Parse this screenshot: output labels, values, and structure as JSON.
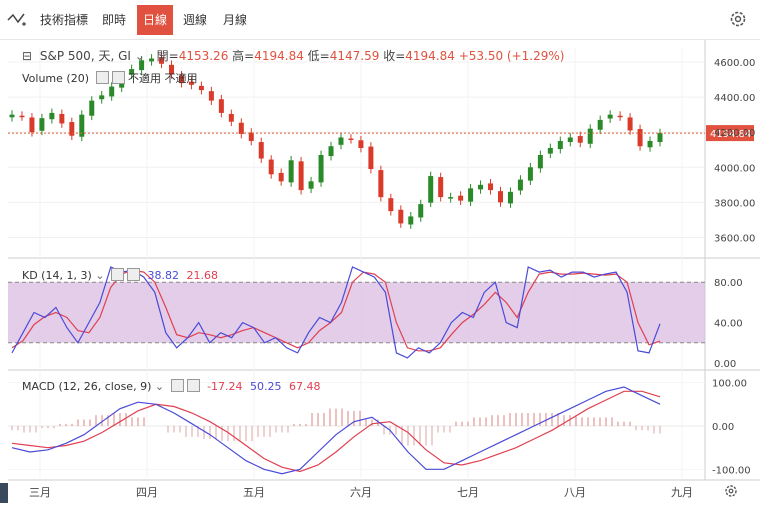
{
  "toolbar": {
    "icon": "line-chart-icon",
    "items": [
      "技術指標",
      "即時",
      "日線",
      "週線",
      "月線"
    ],
    "active_index": 2,
    "settings_icon": "gear-icon"
  },
  "main": {
    "legend_title": "S&P 500, 天, GI",
    "ohlc": {
      "open_label": "開=",
      "open": "4153.26",
      "high_label": "高=",
      "high": "4194.84",
      "low_label": "低=",
      "low": "4147.59",
      "close_label": "收=",
      "close": "4194.84",
      "change": "+53.50 (+1.29%)"
    },
    "volume_label": "Volume (20)",
    "volume_value": "不適用",
    "na_label": "不適用",
    "last_price": "4194.84",
    "up_color": "#2a8a2a",
    "down_color": "#d93a2a"
  },
  "kd": {
    "label": "KD (14, 1, 3)",
    "k_value": "38.82",
    "d_value": "21.68",
    "k_color": "#4a4ad8",
    "d_color": "#e04050",
    "band_color": "#d9b8e0"
  },
  "macd": {
    "label": "MACD (12, 26, close, 9)",
    "hist_value": "-17.24",
    "macd_value": "50.25",
    "signal_value": "67.48"
  },
  "chart_data": [
    {
      "type": "candlestick",
      "title": "S&P 500, 天, GI",
      "x": [
        "三月",
        "四月",
        "五月",
        "六月",
        "七月",
        "八月",
        "九月"
      ],
      "y_ticks": [
        3600,
        3800,
        4000,
        4200,
        4400,
        4600
      ],
      "ylim": [
        3500,
        4680
      ],
      "close_series_approx": [
        4300,
        4290,
        4200,
        4280,
        4310,
        4250,
        4180,
        4300,
        4380,
        4410,
        4460,
        4520,
        4560,
        4610,
        4620,
        4590,
        4530,
        4480,
        4470,
        4440,
        4380,
        4310,
        4260,
        4190,
        4150,
        4050,
        3960,
        3920,
        4040,
        3870,
        3920,
        4070,
        4120,
        4170,
        4160,
        4110,
        3990,
        3830,
        3750,
        3680,
        3720,
        3790,
        3950,
        3830,
        3830,
        3810,
        3880,
        3900,
        3870,
        3800,
        3860,
        3930,
        4000,
        4070,
        4110,
        4150,
        4170,
        4140,
        4220,
        4270,
        4300,
        4290,
        4210,
        4120,
        4150,
        4194.84
      ],
      "last_price": 4194.84
    },
    {
      "type": "line",
      "title": "KD (14, 1, 3)",
      "y_ticks": [
        0,
        40,
        80
      ],
      "ylim": [
        -5,
        100
      ],
      "series": [
        {
          "name": "K",
          "values": [
            10,
            30,
            50,
            45,
            55,
            35,
            20,
            40,
            60,
            95,
            90,
            92,
            85,
            70,
            30,
            15,
            25,
            40,
            20,
            30,
            25,
            40,
            35,
            20,
            25,
            15,
            10,
            30,
            45,
            40,
            60,
            95,
            90,
            85,
            70,
            10,
            5,
            15,
            10,
            20,
            40,
            50,
            45,
            70,
            80,
            40,
            35,
            95,
            90,
            92,
            85,
            90,
            90,
            85,
            88,
            90,
            70,
            12,
            10,
            38.82
          ]
        },
        {
          "name": "D",
          "values": [
            15,
            22,
            38,
            46,
            50,
            45,
            32,
            30,
            45,
            75,
            88,
            92,
            90,
            80,
            55,
            28,
            25,
            30,
            28,
            25,
            28,
            32,
            35,
            30,
            25,
            20,
            15,
            20,
            32,
            40,
            50,
            80,
            90,
            88,
            80,
            40,
            15,
            12,
            12,
            15,
            28,
            40,
            48,
            58,
            70,
            60,
            45,
            70,
            88,
            90,
            88,
            88,
            89,
            88,
            87,
            88,
            80,
            40,
            18,
            21.68
          ]
        }
      ]
    },
    {
      "type": "line",
      "title": "MACD (12, 26, close, 9)",
      "y_ticks": [
        -100,
        0,
        100
      ],
      "ylim": [
        -120,
        120
      ],
      "series": [
        {
          "name": "MACD",
          "values": [
            -50,
            -60,
            -55,
            -40,
            -20,
            10,
            40,
            55,
            50,
            30,
            5,
            -20,
            -50,
            -80,
            -100,
            -110,
            -100,
            -60,
            -20,
            10,
            20,
            -10,
            -60,
            -100,
            -100,
            -80,
            -60,
            -40,
            -20,
            0,
            20,
            40,
            60,
            80,
            90,
            70,
            50.25
          ]
        },
        {
          "name": "Signal",
          "values": [
            -40,
            -45,
            -50,
            -45,
            -35,
            -15,
            10,
            35,
            50,
            45,
            30,
            10,
            -15,
            -45,
            -75,
            -95,
            -105,
            -90,
            -60,
            -25,
            5,
            10,
            -15,
            -55,
            -85,
            -90,
            -80,
            -65,
            -50,
            -30,
            -10,
            15,
            40,
            60,
            80,
            80,
            67.48
          ]
        },
        {
          "name": "Histogram",
          "values": [
            -10,
            -15,
            -5,
            5,
            15,
            25,
            30,
            20,
            0,
            -15,
            -25,
            -30,
            -35,
            -35,
            -25,
            -15,
            5,
            30,
            40,
            35,
            15,
            -20,
            -45,
            -45,
            -15,
            10,
            20,
            25,
            30,
            30,
            30,
            25,
            20,
            20,
            10,
            -10,
            -17.24
          ]
        }
      ]
    }
  ]
}
